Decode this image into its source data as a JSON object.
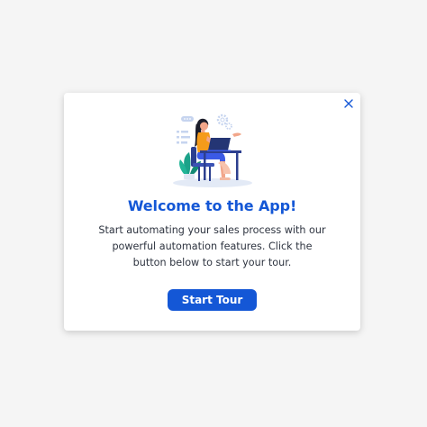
{
  "modal": {
    "title": "Welcome to the App!",
    "body": "Start automating your sales process with our powerful automation features. Click the button below to start your tour.",
    "cta_label": "Start Tour",
    "close_icon": "close-icon",
    "illustration": "woman-working-on-laptop-illustration"
  },
  "colors": {
    "page_background": "#f5f5f5",
    "accent": "#1457d6",
    "body_text": "#2e3440",
    "card_background": "#ffffff"
  }
}
